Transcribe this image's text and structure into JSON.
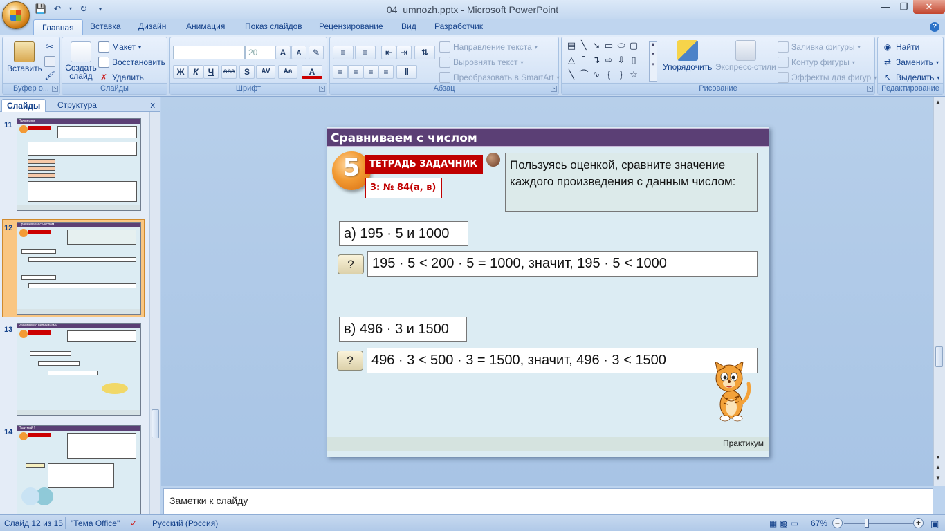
{
  "window": {
    "title": "04_umnozh.pptx - Microsoft PowerPoint"
  },
  "ribbon_tabs": [
    "Главная",
    "Вставка",
    "Дизайн",
    "Анимация",
    "Показ слайдов",
    "Рецензирование",
    "Вид",
    "Разработчик"
  ],
  "ribbon": {
    "clipboard": {
      "paste": "Вставить",
      "label": "Буфер о..."
    },
    "slides": {
      "new_slide": "Создать слайд",
      "layout": "Макет",
      "reset": "Восстановить",
      "delete": "Удалить",
      "label": "Слайды"
    },
    "font": {
      "size": "20",
      "label": "Шрифт",
      "bold": "Ж",
      "italic": "К",
      "underline": "Ч",
      "strike": "abc",
      "shadow": "S",
      "spacing": "AV",
      "case": "Aa",
      "color": "A",
      "grow": "A",
      "shrink": "A"
    },
    "paragraph": {
      "text_direction": "Направление текста",
      "align_text": "Выровнять текст",
      "smartart": "Преобразовать в SmartArt",
      "label": "Абзац"
    },
    "drawing": {
      "arrange": "Упорядочить",
      "quick_styles": "Экспресс-стили",
      "fill": "Заливка фигуры",
      "outline": "Контур фигуры",
      "effects": "Эффекты для фигур",
      "label": "Рисование"
    },
    "editing": {
      "find": "Найти",
      "replace": "Заменить",
      "select": "Выделить",
      "label": "Редактирование"
    }
  },
  "left_pane": {
    "tabs": [
      "Слайды",
      "Структура"
    ],
    "close": "x",
    "thumbnails": [
      {
        "number": "11",
        "title": "Проверим"
      },
      {
        "number": "12",
        "title": "Сравниваем с числом"
      },
      {
        "number": "13",
        "title": "Работаем с величинами"
      },
      {
        "number": "14",
        "title": "Подумай !"
      }
    ]
  },
  "slide": {
    "title": "Сравниваем с числом",
    "number": "5",
    "book_label": "ТЕТРАДЬ ЗАДАЧНИК",
    "task_ref": "3: № 84(а, в)",
    "instruction": "Пользуясь оценкой,  сравните значение  каждого произведения  с данным числом:",
    "task_a": "а) 195 · 5 и 1000",
    "answer_a": "195 · 5 < 200 · 5 = 1000, значит, 195 · 5 < 1000",
    "task_b": "в) 496 · 3 и 1500",
    "answer_b": "496 · 3 < 500 · 3 = 1500, значит, 496 · 3 < 1500",
    "hint_button": "?",
    "footer": "Практикум"
  },
  "notes": {
    "placeholder": "Заметки к слайду"
  },
  "statusbar": {
    "slide_info": "Слайд 12 из 15",
    "theme": "\"Тема Office\"",
    "language": "Русский (Россия)",
    "zoom": "67%"
  },
  "colors": {
    "title_bar": "#5b3f75",
    "slide_bg": "#dcecf3",
    "book_red": "#c00000",
    "ribbon_blue": "#d5e4f6"
  }
}
